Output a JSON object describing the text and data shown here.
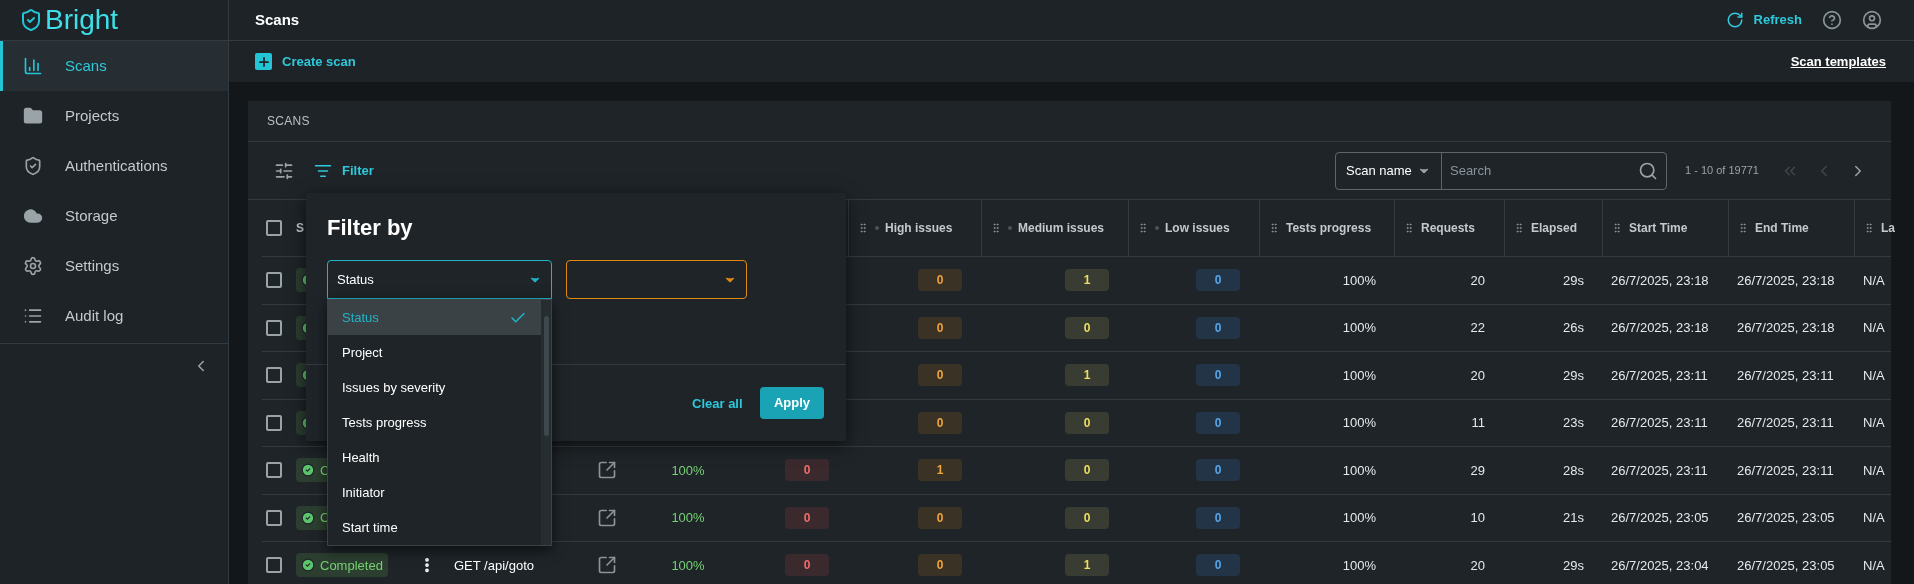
{
  "sidebar": {
    "logo": "Bright",
    "items": [
      {
        "label": "Scans",
        "selected": true
      },
      {
        "label": "Projects",
        "selected": false
      },
      {
        "label": "Authentications",
        "selected": false
      },
      {
        "label": "Storage",
        "selected": false
      },
      {
        "label": "Settings",
        "selected": false
      },
      {
        "label": "Audit log",
        "selected": false
      }
    ]
  },
  "header": {
    "title": "Scans",
    "refresh": "Refresh"
  },
  "actions": {
    "create": "Create scan",
    "templates": "Scan templates"
  },
  "card": {
    "title": "SCANS",
    "filter_button": "Filter",
    "search": {
      "field": "Scan name",
      "placeholder": "Search"
    },
    "pagination": {
      "range": "1 - 10 of 19771",
      "first_disabled": true,
      "prev_disabled": true,
      "next_disabled": false
    }
  },
  "table": {
    "header_checked": false,
    "columns": [
      {
        "label": "S"
      },
      {
        "label": "High issues"
      },
      {
        "label": "Medium issues"
      },
      {
        "label": "Low issues"
      },
      {
        "label": "Tests progress"
      },
      {
        "label": "Requests"
      },
      {
        "label": "Elapsed"
      },
      {
        "label": "Start Time"
      },
      {
        "label": "End Time"
      },
      {
        "label": "La"
      }
    ],
    "rows": [
      {
        "checked": false,
        "status": {
          "kind": "completed"
        },
        "high": "0",
        "medium": "1",
        "low": "0",
        "tests_progress": "100%",
        "requests": "20",
        "elapsed": "29s",
        "start_time": "26/7/2025, 23:18",
        "end_time": "26/7/2025, 23:18",
        "column_16": "N/A"
      },
      {
        "checked": false,
        "status": {
          "kind": "completed"
        },
        "high": "0",
        "medium": "0",
        "low": "0",
        "tests_progress": "100%",
        "requests": "22",
        "elapsed": "26s",
        "start_time": "26/7/2025, 23:18",
        "end_time": "26/7/2025, 23:18",
        "column_16": "N/A"
      },
      {
        "checked": false,
        "status": {
          "kind": "completed"
        },
        "high": "0",
        "medium": "1",
        "low": "0",
        "tests_progress": "100%",
        "requests": "20",
        "elapsed": "29s",
        "start_time": "26/7/2025, 23:11",
        "end_time": "26/7/2025, 23:11",
        "column_16": "N/A"
      },
      {
        "checked": false,
        "status": {
          "kind": "completed"
        },
        "high": "0",
        "medium": "0",
        "low": "0",
        "tests_progress": "100%",
        "requests": "11",
        "elapsed": "23s",
        "start_time": "26/7/2025, 23:11",
        "end_time": "26/7/2025, 23:11",
        "column_16": "N/A"
      },
      {
        "checked": false,
        "status": {
          "kind": "completed",
          "text": "C"
        },
        "link": true,
        "progress": "100%",
        "critical": "0",
        "high": "1",
        "medium": "0",
        "low": "0",
        "tests_progress": "100%",
        "requests": "29",
        "elapsed": "28s",
        "start_time": "26/7/2025, 23:11",
        "end_time": "26/7/2025, 23:11",
        "column_16": "N/A"
      },
      {
        "checked": false,
        "status": {
          "kind": "completed",
          "text": "C"
        },
        "link": true,
        "progress": "100%",
        "critical": "0",
        "high": "0",
        "medium": "0",
        "low": "0",
        "tests_progress": "100%",
        "requests": "10",
        "elapsed": "21s",
        "start_time": "26/7/2025, 23:05",
        "end_time": "26/7/2025, 23:05",
        "column_16": "N/A"
      },
      {
        "checked": false,
        "status": {
          "kind": "completed",
          "text": "Completed"
        },
        "menu": true,
        "name": "GET /api/goto",
        "link": true,
        "progress": "100%",
        "critical": "0",
        "high": "0",
        "medium": "1",
        "low": "0",
        "tests_progress": "100%",
        "requests": "20",
        "elapsed": "29s",
        "start_time": "26/7/2025, 23:04",
        "end_time": "26/7/2025, 23:05",
        "column_16": "N/A"
      }
    ]
  },
  "filter": {
    "title": "Filter by",
    "field_select": {
      "value": "Status",
      "open": true
    },
    "value_select": {
      "invalid": true
    },
    "options": [
      {
        "label": "Status",
        "selected": true
      },
      {
        "label": "Project",
        "selected": false
      },
      {
        "label": "Issues by severity",
        "selected": false
      },
      {
        "label": "Tests progress",
        "selected": false
      },
      {
        "label": "Health",
        "selected": false
      },
      {
        "label": "Initiator",
        "selected": false
      },
      {
        "label": "Start time",
        "selected": false
      }
    ],
    "clear": "Clear all",
    "apply": "Apply"
  }
}
